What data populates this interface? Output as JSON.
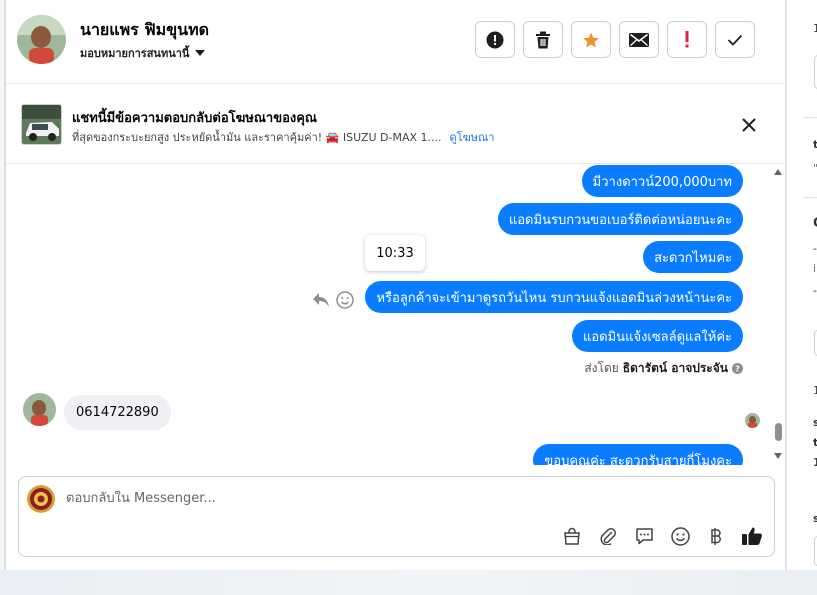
{
  "header": {
    "contact_name": "นายแพร ฟิมขุนทด",
    "assign_label": "มอบหมายการสนทนานี้"
  },
  "ad": {
    "title": "แชทนี้มีข้อความตอบกลับต่อโฆษณาของคุณ",
    "description": "ที่สุดของกระบะยกสูง ประหยัดน้ำมัน และราคาคุ้มค่า! 🚘 ISUZU D-MAX 1....",
    "link": "ดูโฆษณา"
  },
  "conversation": {
    "outgoing": [
      "มีวางดาวน์200,000บาท",
      "แอดมินรบกวนขอเบอร์ติดต่อหน่อยนะคะ",
      "สะดวกไหมคะ",
      "หรือลูกค้าจะเข้ามาดูรถวันไหน รบกวนแจ้งแอดมินล่วงหน้านะคะ",
      "แอดมินแจ้งเซลล์ดูแลให้ค่ะ",
      "ขอบคุณค่ะ สะดวกรับสายกี่โมงคะ"
    ],
    "time_tooltip": "10:33",
    "sent_by_label": "ส่งโดย",
    "sent_by_name": "ธิดารัตน์ อาจประจัน",
    "incoming": "0614722890"
  },
  "composer": {
    "placeholder": "ตอบกลับใน Messenger..."
  },
  "sidebar_fragments": [
    "1",
    "t",
    "\"",
    "C",
    "-",
    "i",
    "-",
    "1",
    "s",
    "t",
    "1",
    "s"
  ],
  "colors": {
    "accent": "#0a7cff",
    "star": "#f0922b",
    "alert": "#e41e3f"
  }
}
